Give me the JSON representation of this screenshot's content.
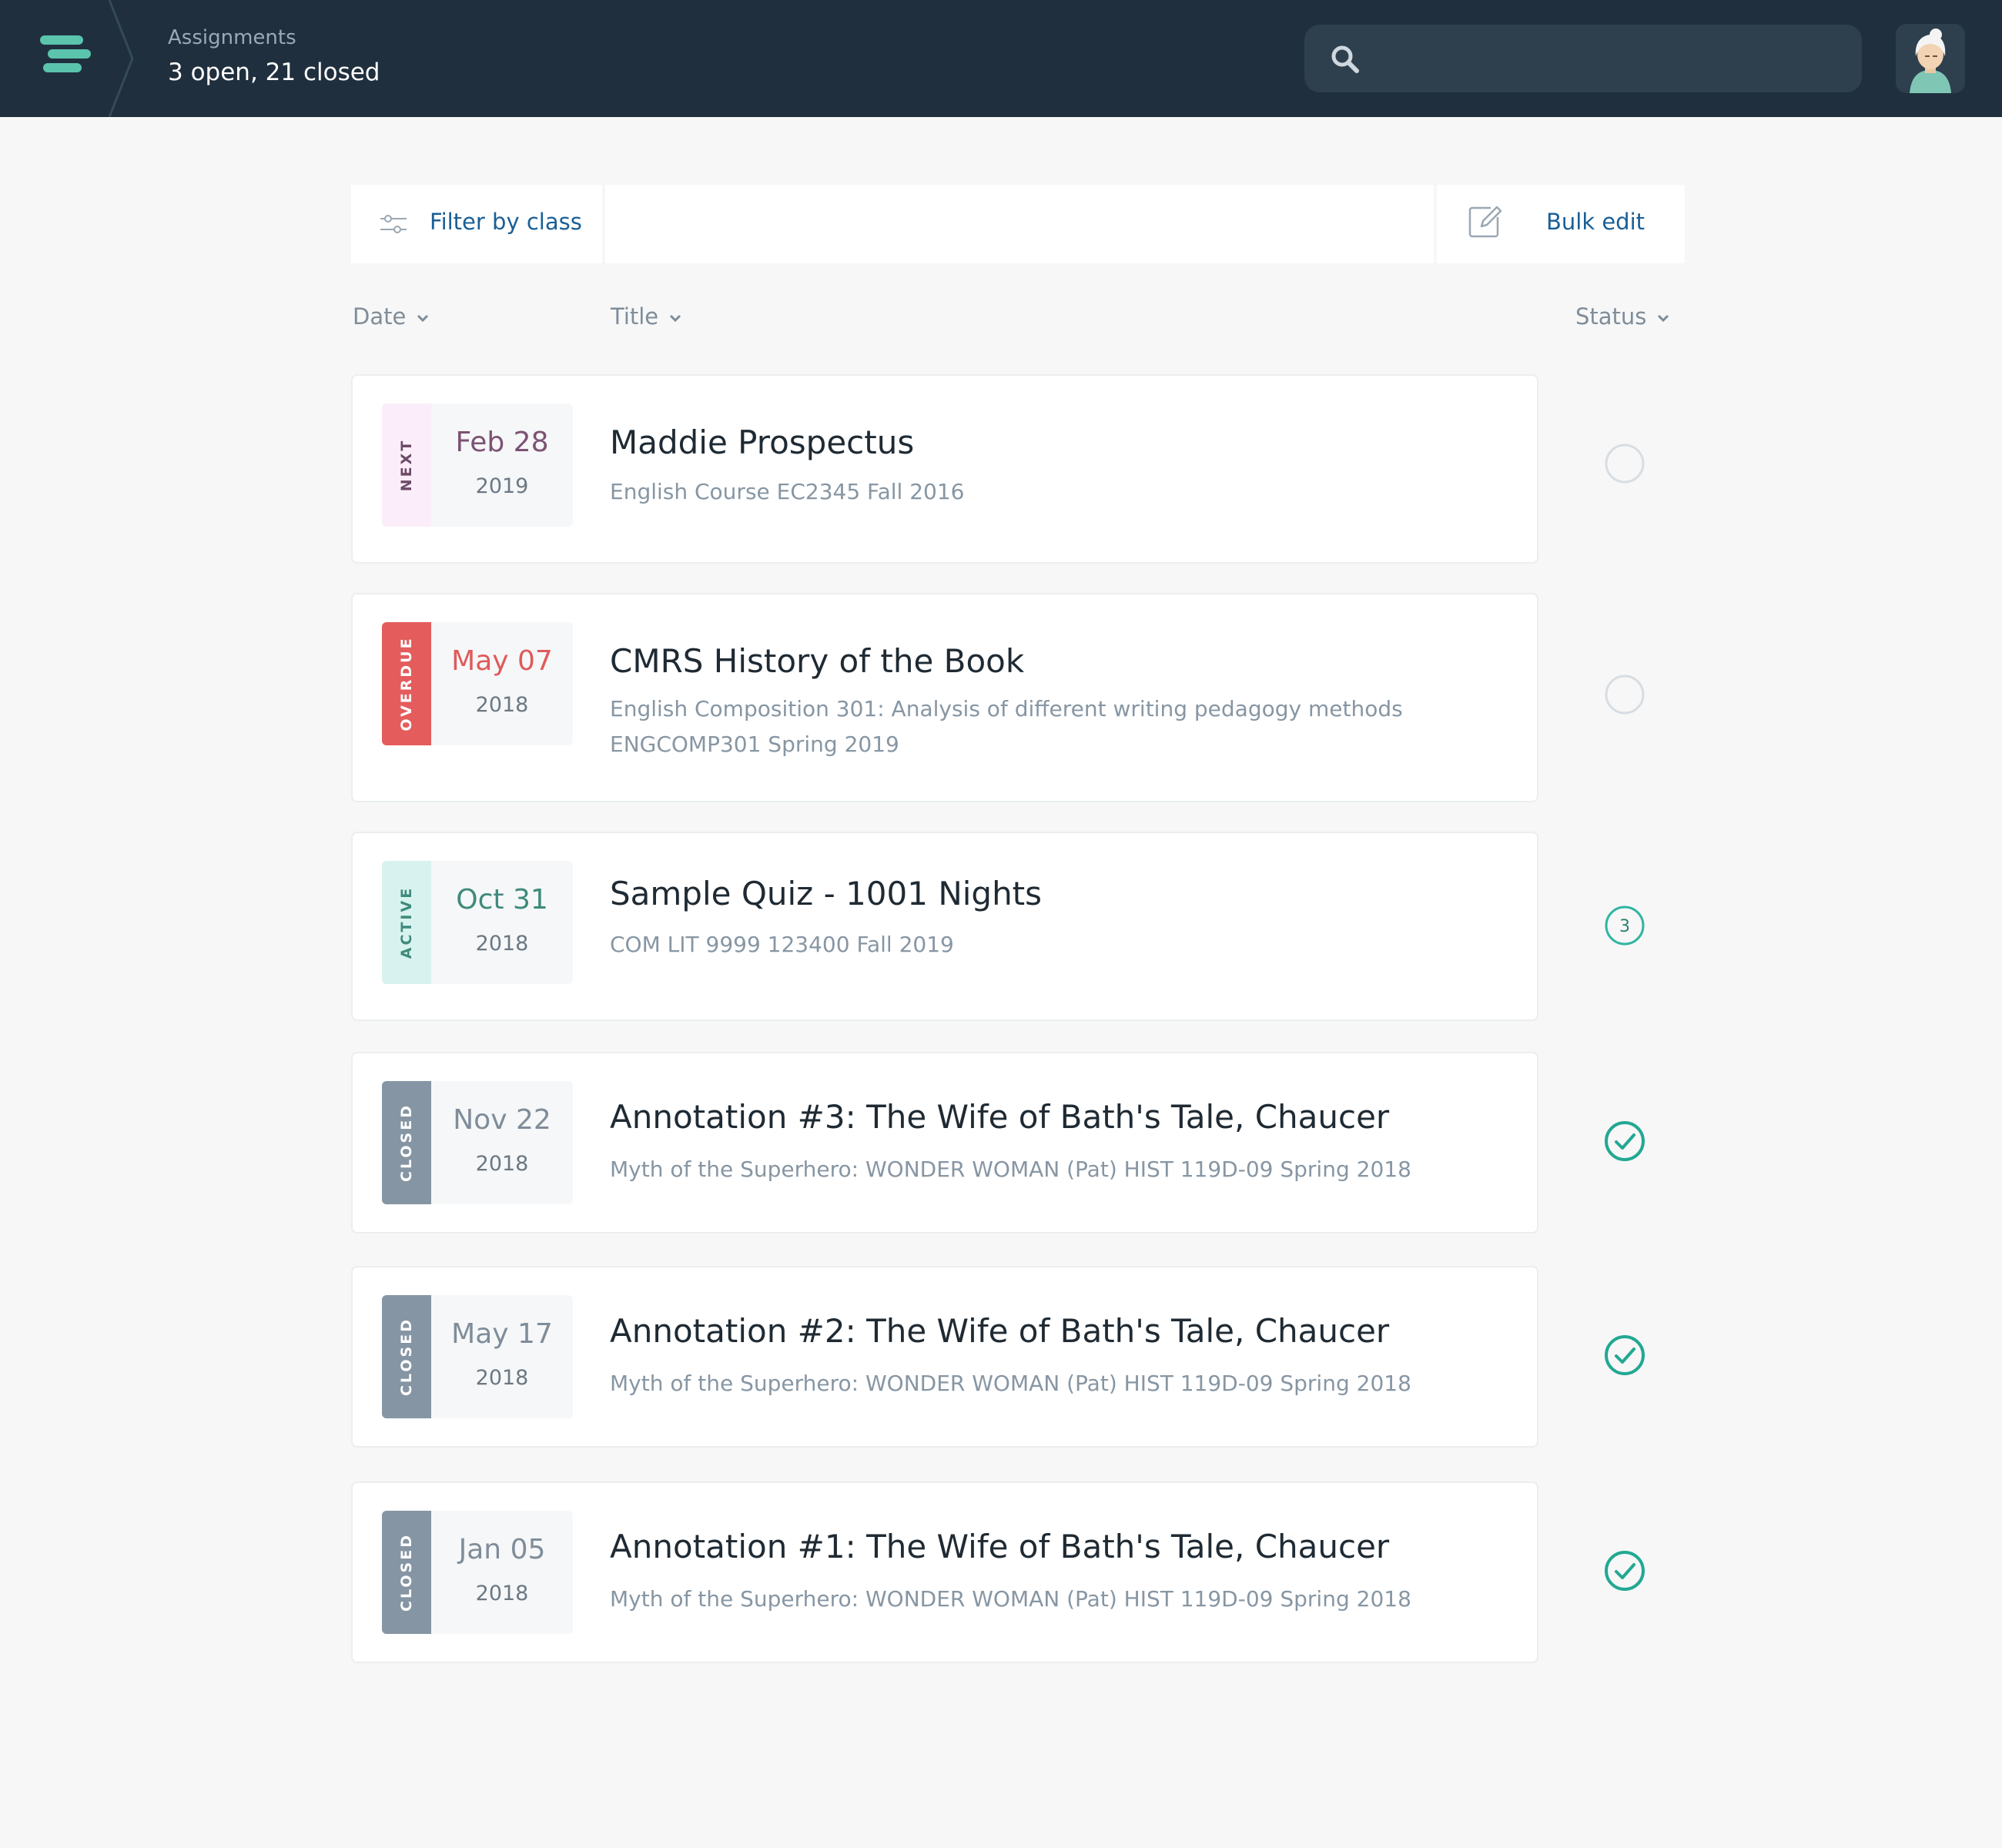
{
  "header": {
    "page_label": "Assignments",
    "counts": "3 open, 21 closed",
    "search": {
      "placeholder": "",
      "value": ""
    },
    "icons": {
      "menu": "menu-icon",
      "search": "search-icon",
      "avatar": "user-avatar"
    }
  },
  "toolbar": {
    "filter_label": "Filter by class",
    "bulk_edit_label": "Bulk edit",
    "icons": {
      "filter": "sliders-icon",
      "bulk_edit": "edit-icon"
    }
  },
  "columns": {
    "date": "Date",
    "title": "Title",
    "status": "Status"
  },
  "colors": {
    "topbar": "#1f2f3d",
    "accent_teal": "#2fb5a1",
    "link_blue": "#1a5f96",
    "next": "#fbeefa",
    "overdue": "#e45c5c",
    "active": "#d8f3ef",
    "closed": "#8595a3"
  },
  "assignments": [
    {
      "tag": "NEXT",
      "date": "Feb 28",
      "year": "2019",
      "title": "Maddie Prospectus",
      "subtitle": [
        "English Course EC2345 Fall 2016"
      ],
      "status": "empty"
    },
    {
      "tag": "OVERDUE",
      "date": "May 07",
      "year": "2018",
      "title": "CMRS History of the Book",
      "subtitle": [
        "English Composition 301: Analysis of different writing pedagogy methods",
        "ENGCOMP301 Spring 2019"
      ],
      "status": "empty"
    },
    {
      "tag": "ACTIVE",
      "date": "Oct 31",
      "year": "2018",
      "title": "Sample Quiz - 1001 Nights",
      "subtitle": [
        "COM LIT 9999 123400 Fall 2019"
      ],
      "status": "count",
      "status_count": "3"
    },
    {
      "tag": "CLOSED",
      "date": "Nov 22",
      "year": "2018",
      "title": "Annotation #3: The Wife of Bath's Tale, Chaucer",
      "subtitle": [
        "Myth of the Superhero: WONDER WOMAN (Pat) HIST 119D-09 Spring 2018"
      ],
      "status": "complete"
    },
    {
      "tag": "CLOSED",
      "date": "May 17",
      "year": "2018",
      "title": "Annotation #2: The Wife of Bath's Tale, Chaucer",
      "subtitle": [
        "Myth of the Superhero: WONDER WOMAN (Pat) HIST 119D-09 Spring 2018"
      ],
      "status": "complete"
    },
    {
      "tag": "CLOSED",
      "date": "Jan 05",
      "year": "2018",
      "title": "Annotation #1: The Wife of Bath's Tale, Chaucer",
      "subtitle": [
        "Myth of the Superhero: WONDER WOMAN (Pat) HIST 119D-09 Spring 2018"
      ],
      "status": "complete"
    }
  ]
}
